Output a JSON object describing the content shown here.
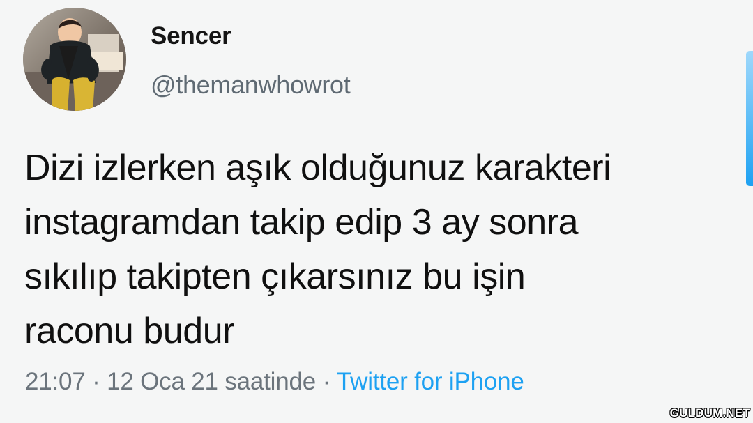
{
  "tweet": {
    "display_name": "Sencer",
    "handle": "@themanwhowrot",
    "text_lines": [
      "Dizi izlerken aşık olduğunuz karakteri",
      "instagramdan takip edip 3 ay sonra",
      "sıkılıp takipten çıkarsınız bu işin",
      "raconu budur"
    ],
    "timestamp": "21:07 · 12 Oca 21 saatinde",
    "separator": " · ",
    "source": "Twitter for iPhone"
  },
  "watermark": "GULDUM.NET",
  "colors": {
    "source_link": "#1da1f2",
    "meta_text": "#6b747c"
  },
  "icons": {
    "avatar": "avatar-photo"
  }
}
